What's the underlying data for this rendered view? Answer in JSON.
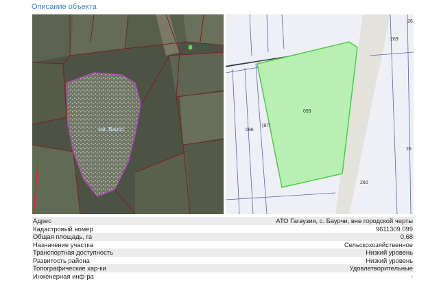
{
  "section_title": "Описание объекта",
  "satellite_map": {
    "settlement_label": "sat. Baurci"
  },
  "cadastral_map": {
    "parcel_labels": {
      "subject": "099",
      "left_parcel": "096",
      "left_inner": "(87)",
      "top_right": "269",
      "edge_top": "26",
      "edge_right": "26",
      "bottom_right": "260"
    },
    "colors": {
      "subject_fill": "#b7f0b2",
      "subject_border": "#4ec94a"
    }
  },
  "table": {
    "rows": [
      {
        "label": "Адрес",
        "value": "АТО Гагаузия, с. Баурчи, вне городской черты"
      },
      {
        "label": "Кадастровый номер",
        "value": "9611309.099"
      },
      {
        "label": "Общая площадь, га",
        "value": "0,68"
      },
      {
        "label": "Назначение участка",
        "value": "Сельскохозяйственное"
      },
      {
        "label": "Транспортная доступность",
        "value": "Низкий уровень"
      },
      {
        "label": "Развитость района",
        "value": "Низкий уровень"
      },
      {
        "label": "Топографические хар-ки",
        "value": "Удовлетворительные"
      },
      {
        "label": "Инженерная инф-ра",
        "value": "-"
      }
    ]
  }
}
